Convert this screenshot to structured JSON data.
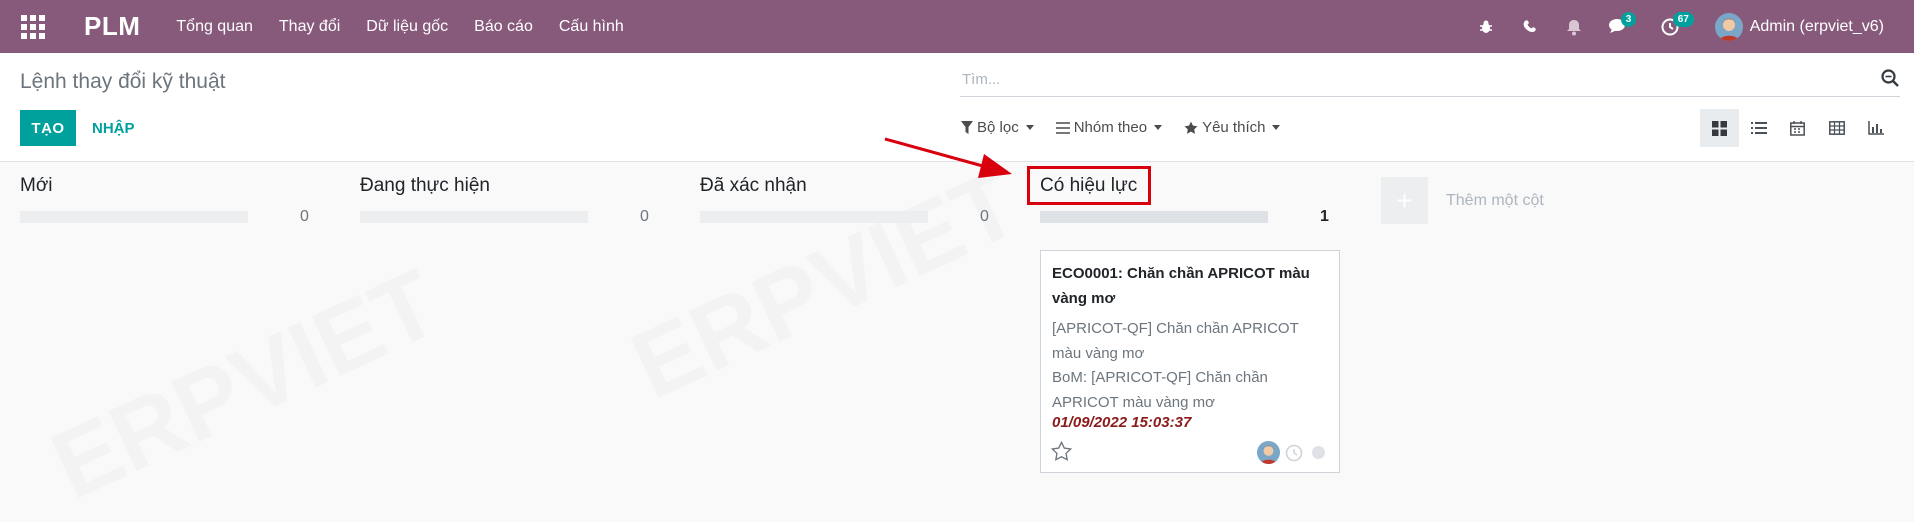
{
  "navbar": {
    "brand": "PLM",
    "menu": [
      "Tổng quan",
      "Thay đổi",
      "Dữ liệu gốc",
      "Báo cáo",
      "Cấu hình"
    ],
    "badges": {
      "messages": "3",
      "activities": "67"
    },
    "user_name": "Admin (erpviet_v6)"
  },
  "control": {
    "breadcrumb": "Lệnh thay đổi kỹ thuật",
    "create_label": "TẠO",
    "import_label": "NHẬP",
    "search_placeholder": "Tìm...",
    "filter_label": "Bộ lọc",
    "groupby_label": "Nhóm theo",
    "favorites_label": "Yêu thích"
  },
  "kanban": {
    "columns": [
      {
        "title": "Mới",
        "count": "0"
      },
      {
        "title": "Đang thực hiện",
        "count": "0"
      },
      {
        "title": "Đã xác nhận",
        "count": "0"
      },
      {
        "title": "Có hiệu lực",
        "count": "1"
      }
    ],
    "add_column_label": "Thêm một cột",
    "card": {
      "title": "ECO0001: Chăn chần APRICOT màu vàng mơ",
      "product": "[APRICOT-QF] Chăn chần APRICOT màu vàng mơ",
      "bom": "BoM: [APRICOT-QF] Chăn chần APRICOT màu vàng mơ",
      "date": "01/09/2022 15:03:37"
    }
  },
  "colors": {
    "navbar": "#875a7b",
    "primary": "#00a09d",
    "highlight": "#d9000d",
    "date": "#8b1a1a"
  },
  "icons": [
    "apps-grid-icon",
    "bug-icon",
    "phone-icon",
    "bell-icon",
    "chat-icon",
    "clock-icon",
    "search-icon",
    "filter-icon",
    "groupby-icon",
    "star-icon",
    "kanban-view-icon",
    "list-view-icon",
    "calendar-view-icon",
    "pivot-view-icon",
    "graph-view-icon",
    "red-arrow-annotation"
  ]
}
